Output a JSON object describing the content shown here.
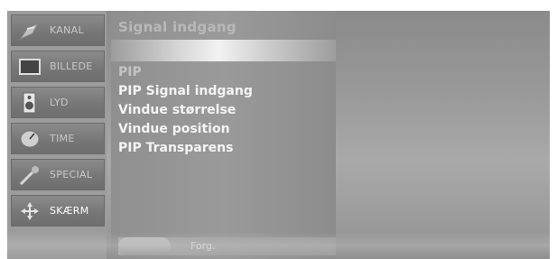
{
  "sidebar": {
    "items": [
      {
        "label": "KANAL",
        "icon": "satellite-dish-icon"
      },
      {
        "label": "BILLEDE",
        "icon": "tv-screen-icon"
      },
      {
        "label": "LYD",
        "icon": "speaker-icon"
      },
      {
        "label": "TIME",
        "icon": "clock-icon"
      },
      {
        "label": "SPECIAL",
        "icon": "special-wand-icon"
      },
      {
        "label": "SKÆRM",
        "icon": "move-arrows-icon"
      }
    ]
  },
  "panel": {
    "title": "Signal indgang",
    "items": [
      "PIP",
      "PIP Signal indgang",
      "Vindue størrelse",
      "Vindue position",
      "PIP Transparens"
    ],
    "footer_label": "Forg."
  },
  "colors": {
    "text_active": "#ffffff",
    "text_dim": "#c9c9c9",
    "bar_highlight": "#f2f2f2"
  }
}
